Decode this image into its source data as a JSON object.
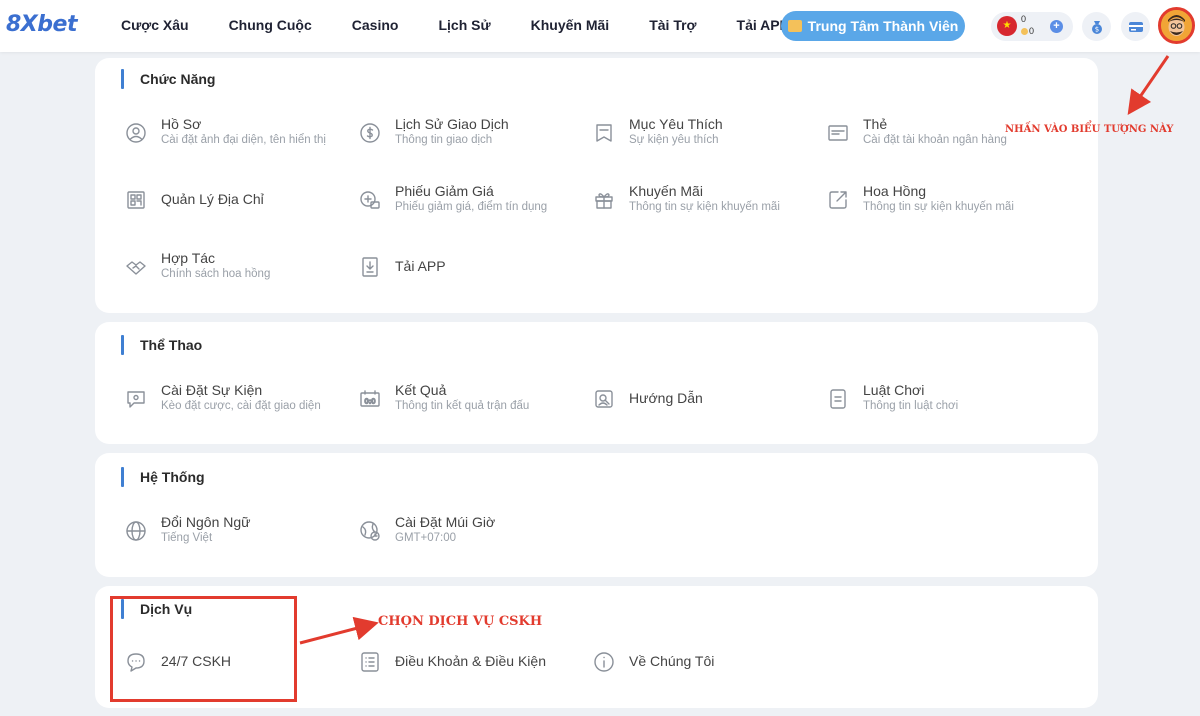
{
  "header": {
    "logo": "8Xbet",
    "nav": [
      "Cược Xâu",
      "Chung Cuộc",
      "Casino",
      "Lịch Sử",
      "Khuyến Mãi",
      "Tài Trợ",
      "Tải APP"
    ],
    "member_button": "Trung Tâm Thành Viên",
    "wallet": {
      "flag": "★",
      "balance": "0",
      "coin_balance": "0",
      "add": "+"
    },
    "colors": {
      "accent": "#5aa7e8",
      "logo": "#3b6fd0"
    }
  },
  "sections": {
    "chuc_nang": {
      "title": "Chức Năng",
      "items": [
        {
          "label": "Hồ Sơ",
          "sub": "Cài đặt ảnh đại diện, tên hiển thị",
          "icon": "user-icon"
        },
        {
          "label": "Lịch Sử Giao Dịch",
          "sub": "Thông tin giao dịch",
          "icon": "dollar-circle-icon"
        },
        {
          "label": "Mục Yêu Thích",
          "sub": "Sự kiện yêu thích",
          "icon": "bookmark-icon"
        },
        {
          "label": "Thẻ",
          "sub": "Cài đặt tài khoản ngân hàng",
          "icon": "card-icon"
        },
        {
          "label": "Quản Lý Địa Chỉ",
          "sub": "",
          "icon": "qr-code-icon"
        },
        {
          "label": "Phiếu Giảm Giá",
          "sub": "Phiếu giảm giá, điểm tín dụng",
          "icon": "coupon-icon"
        },
        {
          "label": "Khuyến Mãi",
          "sub": "Thông tin sự kiện khuyến mãi",
          "icon": "gift-icon"
        },
        {
          "label": "Hoa Hồng",
          "sub": "Thông tin sự kiện khuyến mãi",
          "icon": "share-icon"
        },
        {
          "label": "Hợp Tác",
          "sub": "Chính sách hoa hồng",
          "icon": "handshake-icon"
        },
        {
          "label": "Tải APP",
          "sub": "",
          "icon": "download-icon"
        }
      ]
    },
    "the_thao": {
      "title": "Thể Thao",
      "items": [
        {
          "label": "Cài Đặt Sự Kiện",
          "sub": "Kèo đặt cược, cài đặt giao diện",
          "icon": "settings-chat-icon"
        },
        {
          "label": "Kết Quả",
          "sub": "Thông tin kết quả trận đấu",
          "icon": "scoreboard-icon"
        },
        {
          "label": "Hướng Dẫn",
          "sub": "",
          "icon": "guide-icon"
        },
        {
          "label": "Luật Chơi",
          "sub": "Thông tin luật chơi",
          "icon": "rules-icon"
        }
      ]
    },
    "he_thong": {
      "title": "Hệ Thống",
      "items": [
        {
          "label": "Đổi Ngôn Ngữ",
          "sub": "Tiếng Việt",
          "icon": "globe-icon"
        },
        {
          "label": "Cài Đặt Múi Giờ",
          "sub": "GMT+07:00",
          "icon": "timezone-icon"
        }
      ]
    },
    "dich_vu": {
      "title": "Dịch Vụ",
      "items": [
        {
          "label": "24/7 CSKH",
          "icon": "chat-bubble-icon"
        },
        {
          "label": "Điều Khoản & Điều Kiện",
          "icon": "list-icon"
        },
        {
          "label": "Về Chúng Tôi",
          "icon": "info-icon"
        }
      ]
    }
  },
  "annotations": {
    "avatar_note": "NHẤN VÀO BIỂU TƯỢNG NÀY",
    "service_note": "CHỌN DỊCH VỤ CSKH",
    "color": "#e23b2e"
  }
}
